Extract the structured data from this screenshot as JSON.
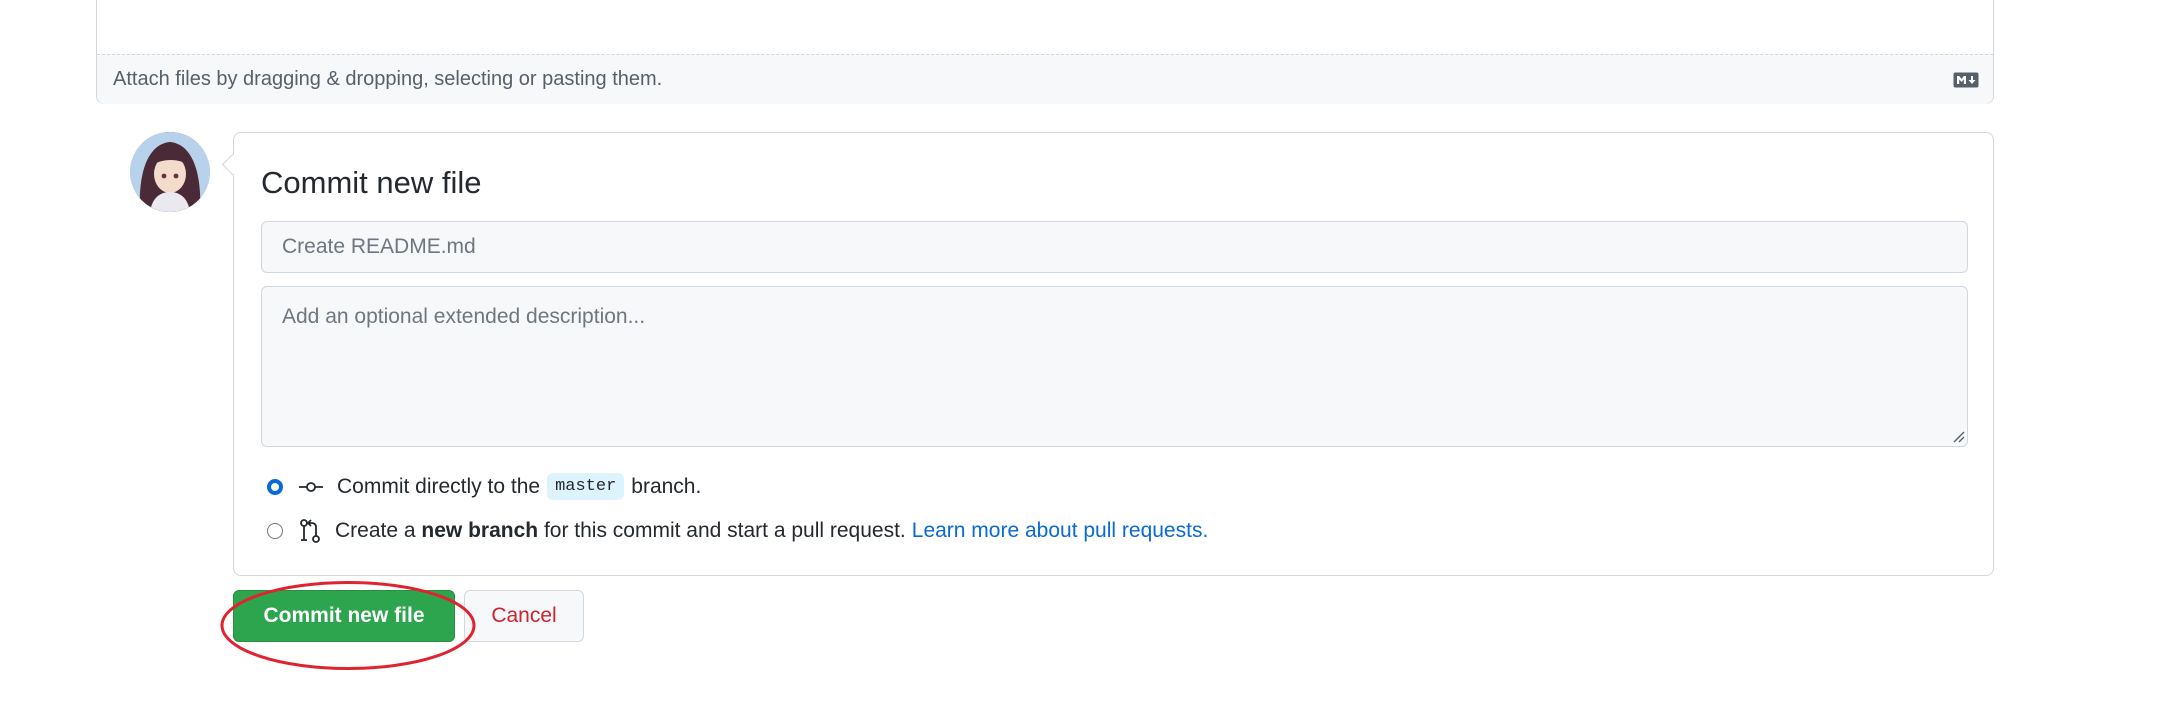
{
  "editor": {
    "attach_hint": "Attach files by dragging & dropping, selecting or pasting them.",
    "markdown_icon": "markdown-icon"
  },
  "commit": {
    "title": "Commit new file",
    "summary_placeholder": "Create README.md",
    "description_placeholder": "Add an optional extended description...",
    "option_direct": {
      "prefix": "Commit directly to the",
      "branch": "master",
      "suffix": "branch.",
      "icon": "git-commit-icon",
      "checked": true
    },
    "option_new_branch": {
      "prefix": "Create a",
      "bold": "new branch",
      "suffix": "for this commit and start a pull request.",
      "link": "Learn more about pull requests.",
      "icon": "git-pull-request-icon",
      "checked": false
    }
  },
  "buttons": {
    "commit_label": "Commit new file",
    "cancel_label": "Cancel"
  },
  "colors": {
    "primary_green": "#2da44e",
    "link_blue": "#0969da",
    "danger_red": "#cf222e",
    "annotation_red": "#e0242f"
  }
}
